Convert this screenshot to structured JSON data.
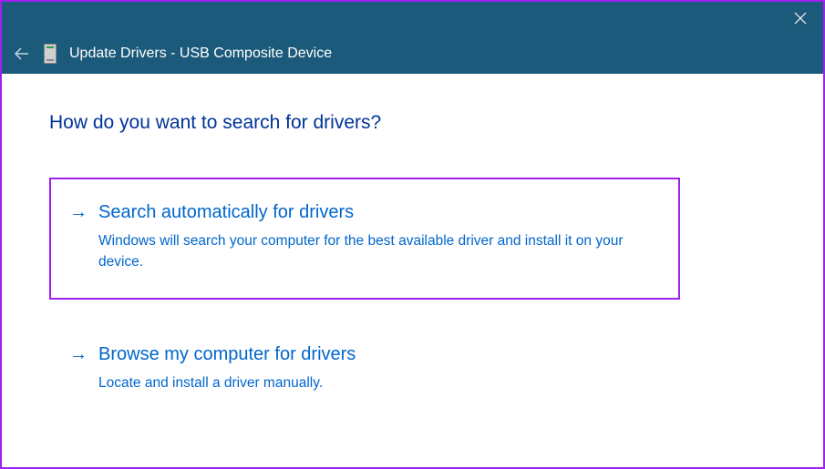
{
  "titlebar": {
    "close_label": "Close"
  },
  "header": {
    "back_label": "Back",
    "title": "Update Drivers - USB Composite Device"
  },
  "content": {
    "prompt": "How do you want to search for drivers?",
    "options": [
      {
        "title": "Search automatically for drivers",
        "description": "Windows will search your computer for the best available driver and install it on your device.",
        "highlighted": true
      },
      {
        "title": "Browse my computer for drivers",
        "description": "Locate and install a driver manually.",
        "highlighted": false
      }
    ]
  }
}
